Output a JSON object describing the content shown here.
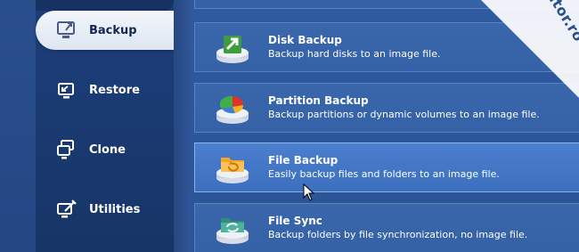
{
  "sidebar": {
    "items": [
      {
        "label": "Backup",
        "icon": "backup-icon",
        "active": true
      },
      {
        "label": "Restore",
        "icon": "restore-icon",
        "active": false
      },
      {
        "label": "Clone",
        "icon": "clone-icon",
        "active": false
      },
      {
        "label": "Utilities",
        "icon": "utilities-icon",
        "active": false
      }
    ]
  },
  "cards": [
    {
      "title": "Disk Backup",
      "desc": "Backup hard disks to an image file.",
      "icon": "disk-backup-icon"
    },
    {
      "title": "Partition Backup",
      "desc": "Backup partitions or dynamic volumes to an image file.",
      "icon": "partition-backup-icon"
    },
    {
      "title": "File Backup",
      "desc": "Easily backup files and folders to an image file.",
      "icon": "file-backup-icon",
      "hover": true
    },
    {
      "title": "File Sync",
      "desc": "Backup folders by file synchronization, no image file.",
      "icon": "file-sync-icon"
    }
  ],
  "watermark": {
    "text": "programecalculator.ro"
  },
  "colors": {
    "accent": "#3561a7",
    "hover": "#4b7fcf",
    "sidebar": "#1a3a72"
  }
}
